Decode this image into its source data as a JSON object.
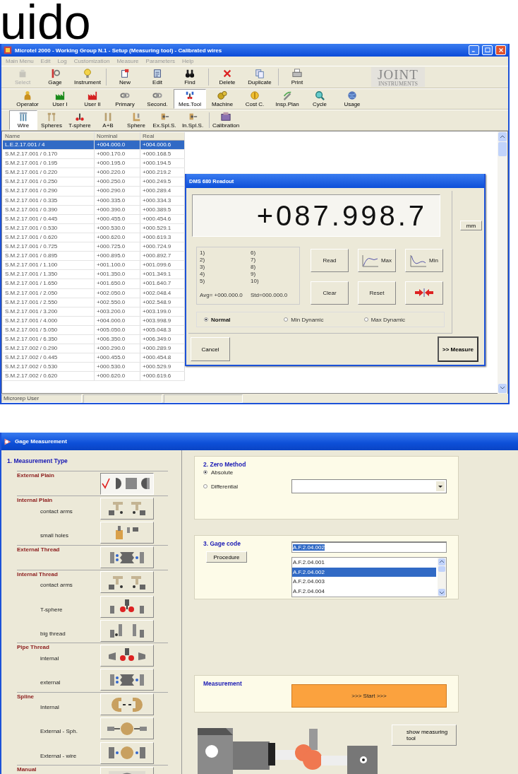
{
  "page_heading": "uido",
  "main_window": {
    "title": "Microtel 2000 - Working Group N.1 - Setup (Measuring tool) - Calibrated wires",
    "menu": [
      "Main Menu",
      "Edit",
      "Log",
      "Customization",
      "Measure",
      "Parameters",
      "Help"
    ],
    "toolbars": [
      {
        "items": [
          {
            "label": "Select",
            "disabled": true
          },
          {
            "label": "Gage",
            "disabled": false
          },
          {
            "label": "Instrument",
            "disabled": false
          },
          {
            "label": "New",
            "disabled": false
          },
          {
            "label": "Edit",
            "disabled": false
          },
          {
            "label": "Find",
            "disabled": false
          },
          {
            "label": "Delete",
            "disabled": false
          },
          {
            "label": "Duplicate",
            "disabled": false
          },
          {
            "label": "Print",
            "disabled": false
          }
        ]
      },
      {
        "items": [
          {
            "label": "Operator",
            "selected": false
          },
          {
            "label": "User I",
            "selected": false
          },
          {
            "label": "User II",
            "selected": false
          },
          {
            "label": "Primary",
            "selected": false
          },
          {
            "label": "Second.",
            "selected": false
          },
          {
            "label": "Mes.Tool",
            "selected": true
          },
          {
            "label": "Machine",
            "selected": false
          },
          {
            "label": "Cost C.",
            "selected": false
          },
          {
            "label": "Insp.Plan",
            "selected": false
          },
          {
            "label": "Cycle",
            "selected": false
          },
          {
            "label": "Usage",
            "selected": false
          }
        ]
      },
      {
        "items": [
          {
            "label": "Wire",
            "selected": true
          },
          {
            "label": "Spheres",
            "selected": false
          },
          {
            "label": "T-sphere",
            "selected": false
          },
          {
            "label": "A+B",
            "selected": false
          },
          {
            "label": "Sphere",
            "selected": false
          },
          {
            "label": "Ex.Spl.S.",
            "selected": false
          },
          {
            "label": "In.Spl.S.",
            "selected": false
          },
          {
            "label": "Calibration",
            "selected": false
          }
        ]
      }
    ],
    "logo": {
      "text": "JOINT",
      "subtext": "INSTRUMENTS"
    },
    "table": {
      "columns": [
        "Name",
        "Nominal",
        "Real"
      ],
      "rows": [
        {
          "cells": [
            "L.E.2.17.001 / 4",
            "+004.000.0",
            "+004.000.6"
          ],
          "selected": true
        },
        {
          "cells": [
            "S.M.2.17.001 / 0.170",
            "+000.170.0",
            "+000.168.5"
          ],
          "selected": false
        },
        {
          "cells": [
            "S.M.2.17.001 / 0.195",
            "+000.195.0",
            "+000.194.5"
          ],
          "selected": false
        },
        {
          "cells": [
            "S.M.2.17.001 / 0.220",
            "+000.220.0",
            "+000.219.2"
          ],
          "selected": false
        },
        {
          "cells": [
            "S.M.2.17.001 / 0.250",
            "+000.250.0",
            "+000.249.5"
          ],
          "selected": false
        },
        {
          "cells": [
            "S.M.2.17.001 / 0.290",
            "+000.290.0",
            "+000.289.4"
          ],
          "selected": false
        },
        {
          "cells": [
            "S.M.2.17.001 / 0.335",
            "+000.335.0",
            "+000.334.3"
          ],
          "selected": false
        },
        {
          "cells": [
            "S.M.2.17.001 / 0.390",
            "+000.390.0",
            "+000.389.5"
          ],
          "selected": false
        },
        {
          "cells": [
            "S.M.2.17.001 / 0.445",
            "+000.455.0",
            "+000.454.6"
          ],
          "selected": false
        },
        {
          "cells": [
            "S.M.2.17.001 / 0.530",
            "+000.530.0",
            "+000.529.1"
          ],
          "selected": false
        },
        {
          "cells": [
            "S.M.2.17.001 / 0.620",
            "+000.620.0",
            "+000.619.3"
          ],
          "selected": false
        },
        {
          "cells": [
            "S.M.2.17.001 / 0.725",
            "+000.725.0",
            "+000.724.9"
          ],
          "selected": false
        },
        {
          "cells": [
            "S.M.2.17.001 / 0.895",
            "+000.895.0",
            "+000.892.7"
          ],
          "selected": false
        },
        {
          "cells": [
            "S.M.2.17.001 / 1.100",
            "+001.100.0",
            "+001.099.6"
          ],
          "selected": false
        },
        {
          "cells": [
            "S.M.2.17.001 / 1.350",
            "+001.350.0",
            "+001.349.1"
          ],
          "selected": false
        },
        {
          "cells": [
            "S.M.2.17.001 / 1.650",
            "+001.650.0",
            "+001.640.7"
          ],
          "selected": false
        },
        {
          "cells": [
            "S.M.2.17.001 / 2.050",
            "+002.050.0",
            "+002.048.4"
          ],
          "selected": false
        },
        {
          "cells": [
            "S.M.2.17.001 / 2.550",
            "+002.550.0",
            "+002.548.9"
          ],
          "selected": false
        },
        {
          "cells": [
            "S.M.2.17.001 / 3.200",
            "+003.200.0",
            "+003.199.0"
          ],
          "selected": false
        },
        {
          "cells": [
            "S.M.2.17.001 / 4.000",
            "+004.000.0",
            "+003.998.9"
          ],
          "selected": false
        },
        {
          "cells": [
            "S.M.2.17.001 / 5.050",
            "+005.050.0",
            "+005.048.3"
          ],
          "selected": false
        },
        {
          "cells": [
            "S.M.2.17.001 / 6.350",
            "+006.350.0",
            "+006.349.0"
          ],
          "selected": false
        },
        {
          "cells": [
            "S.M.2.17.002 / 0.290",
            "+000.290.0",
            "+000.289.9"
          ],
          "selected": false
        },
        {
          "cells": [
            "S.M.2.17.002 / 0.445",
            "+000.455.0",
            "+000.454.8"
          ],
          "selected": false
        },
        {
          "cells": [
            "S.M.2.17.002 / 0.530",
            "+000.530.0",
            "+000.529.9"
          ],
          "selected": false
        },
        {
          "cells": [
            "S.M.2.17.002 / 0.620",
            "+000.620.0",
            "+000.619.6"
          ],
          "selected": false
        }
      ]
    },
    "status_bar": "Microrep User",
    "dialog": {
      "title": "DMS 680 Readout",
      "display": "+087.998.7",
      "unit_button": "mm",
      "readings": [
        "1)",
        "2)",
        "3)",
        "4)",
        "5)",
        "6)",
        "7)",
        "8)",
        "9)",
        "10)"
      ],
      "average": "Avg= +000.000.0",
      "std": "Std=000.000.0",
      "buttons": [
        {
          "kind": "text",
          "label": "Read"
        },
        {
          "kind": "max",
          "label": "Max"
        },
        {
          "kind": "min",
          "label": "Min"
        },
        {
          "kind": "text",
          "label": "Clear"
        },
        {
          "kind": "text",
          "label": "Reset"
        },
        {
          "kind": "arrows"
        }
      ],
      "modes": [
        {
          "label": "Normal",
          "selected": true
        },
        {
          "label": "Min Dynamic",
          "selected": false
        },
        {
          "label": "Max Dynamic",
          "selected": false
        }
      ],
      "cancel_button": "Cancel",
      "measure_button": ">> Measure"
    }
  },
  "gage_window": {
    "title": "Gage Measurement",
    "measurement_type": {
      "title": "1. Measurement Type",
      "categories": [
        {
          "name": "External Plain",
          "options": [
            {
              "selected": true
            }
          ]
        },
        {
          "name": "Internal Plain",
          "options": [
            {
              "label": "contact arms",
              "selected": false
            },
            {
              "label": "small holes",
              "selected": false
            }
          ]
        },
        {
          "name": "External Thread",
          "options": [
            {
              "selected": false
            }
          ]
        },
        {
          "name": "Internal Thread",
          "options": [
            {
              "label": "contact arms",
              "selected": false
            },
            {
              "label": "T-sphere",
              "selected": false
            },
            {
              "label": "big thread",
              "selected": false
            }
          ]
        },
        {
          "name": "Pipe Thread",
          "options": [
            {
              "label": "internal",
              "selected": false
            },
            {
              "label": "external",
              "selected": false
            }
          ]
        },
        {
          "name": "Spline",
          "options": [
            {
              "label": "Internal",
              "selected": false
            },
            {
              "label": "External - Sph.",
              "selected": false
            },
            {
              "label": "External - wire",
              "selected": false
            }
          ]
        },
        {
          "name": "Manual",
          "options": [
            {
              "selected": false
            }
          ]
        }
      ]
    },
    "zero_method": {
      "title": "2. Zero Method",
      "options": [
        {
          "label": "Absolute",
          "selected": true
        },
        {
          "label": "Differential",
          "selected": false
        }
      ]
    },
    "gage_code": {
      "title": "3. Gage code",
      "procedure_button": "Procedure",
      "value": "A.F.2.04.002",
      "list": [
        {
          "label": "A.F.2.04.001",
          "selected": false
        },
        {
          "label": "A.F.2.04.002",
          "selected": true
        },
        {
          "label": "A.F.2.04.003",
          "selected": false
        },
        {
          "label": "A.F.2.04.004",
          "selected": false
        }
      ]
    },
    "measurement": {
      "title": "Measurement",
      "start_button": ">>> Start >>>"
    },
    "show_tool_button": "show measuring tool"
  }
}
